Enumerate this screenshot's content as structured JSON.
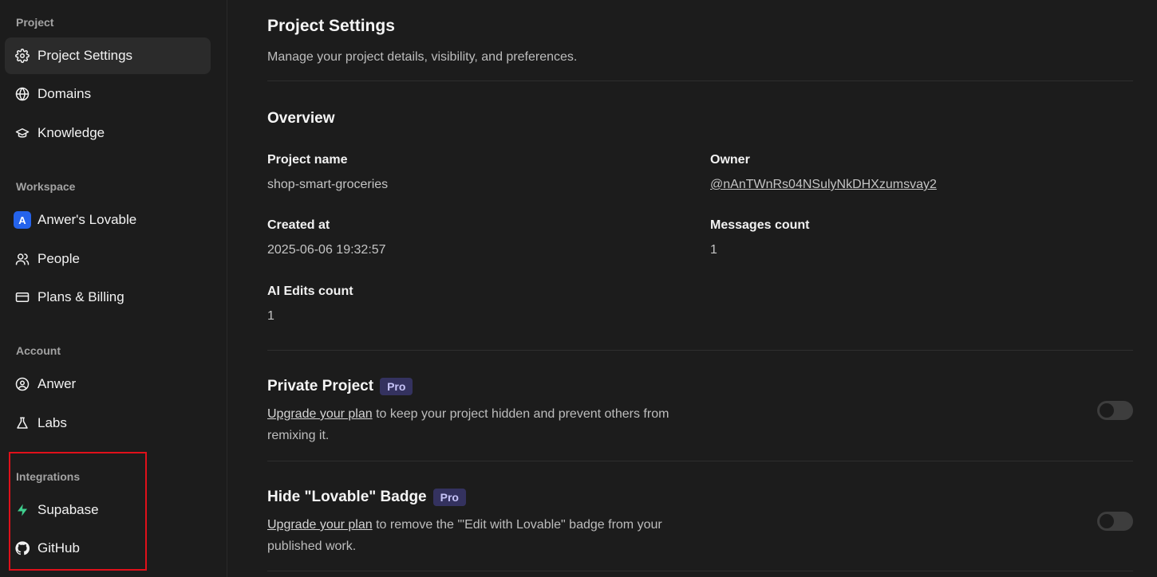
{
  "sidebar": {
    "sections": {
      "project": "Project",
      "workspace": "Workspace",
      "account": "Account",
      "integrations": "Integrations"
    },
    "items": {
      "project_settings": "Project Settings",
      "domains": "Domains",
      "knowledge": "Knowledge",
      "workspace_name": "Anwer's Lovable",
      "workspace_initial": "A",
      "people": "People",
      "plans_billing": "Plans & Billing",
      "account_name": "Anwer",
      "labs": "Labs",
      "supabase": "Supabase",
      "github": "GitHub"
    },
    "active": "project_settings"
  },
  "main": {
    "title": "Project Settings",
    "subtitle": "Manage your project details, visibility, and preferences.",
    "overview": {
      "heading": "Overview",
      "project_name_label": "Project name",
      "project_name_value": "shop-smart-groceries",
      "owner_label": "Owner",
      "owner_value": "@nAnTWnRs04NSulyNkDHXzumsvay2",
      "created_label": "Created at",
      "created_value": "2025-06-06 19:32:57",
      "messages_label": "Messages count",
      "messages_value": "1",
      "ai_edits_label": "AI Edits count",
      "ai_edits_value": "1"
    },
    "private_project": {
      "title": "Private Project",
      "badge": "Pro",
      "link": "Upgrade your plan",
      "desc": " to keep your project hidden and prevent others from remixing it.",
      "enabled": false
    },
    "hide_badge": {
      "title": "Hide \"Lovable\" Badge",
      "badge": "Pro",
      "link": "Upgrade your plan",
      "desc": " to remove the '\"Edit with Lovable\" badge from your published work.",
      "enabled": false
    }
  },
  "colors": {
    "background": "#1c1c1c",
    "active_item": "#2b2b2b",
    "pro_badge": "#34325f",
    "supabase_green": "#3ecf8e",
    "highlight": "#e0101a"
  }
}
